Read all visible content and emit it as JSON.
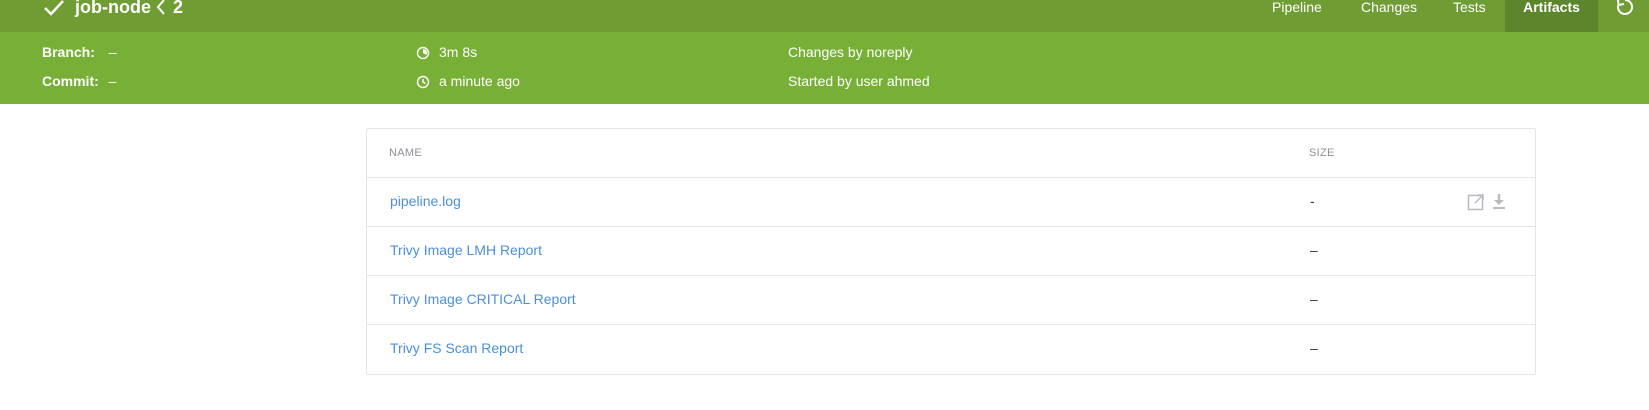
{
  "header": {
    "job_name": "job-node",
    "run_number": "2",
    "nav": {
      "pipeline": "Pipeline",
      "changes": "Changes",
      "tests": "Tests",
      "artifacts": "Artifacts"
    },
    "icons": {
      "status": "check-icon",
      "back": "chevron-left-icon",
      "rerun": "replay-icon"
    }
  },
  "run_info": {
    "branch_label": "Branch:",
    "branch_value": "–",
    "commit_label": "Commit:",
    "commit_value": "–",
    "duration": "3m 8s",
    "finished": "a minute ago",
    "changes": "Changes by noreply",
    "started_by": "Started by user ahmed"
  },
  "artifacts": {
    "columns": {
      "name": "NAME",
      "size": "SIZE"
    },
    "rows": [
      {
        "name": "pipeline.log",
        "size": "-"
      },
      {
        "name": "Trivy Image LMH Report",
        "size": "–"
      },
      {
        "name": "Trivy Image CRITICAL Report",
        "size": "–"
      },
      {
        "name": "Trivy FS Scan Report",
        "size": "–"
      }
    ]
  },
  "colors": {
    "header_bg": "#6f9c33",
    "subheader_bg": "#78b037",
    "active_tab_bg": "#5d852b",
    "link": "#4a90d9"
  }
}
